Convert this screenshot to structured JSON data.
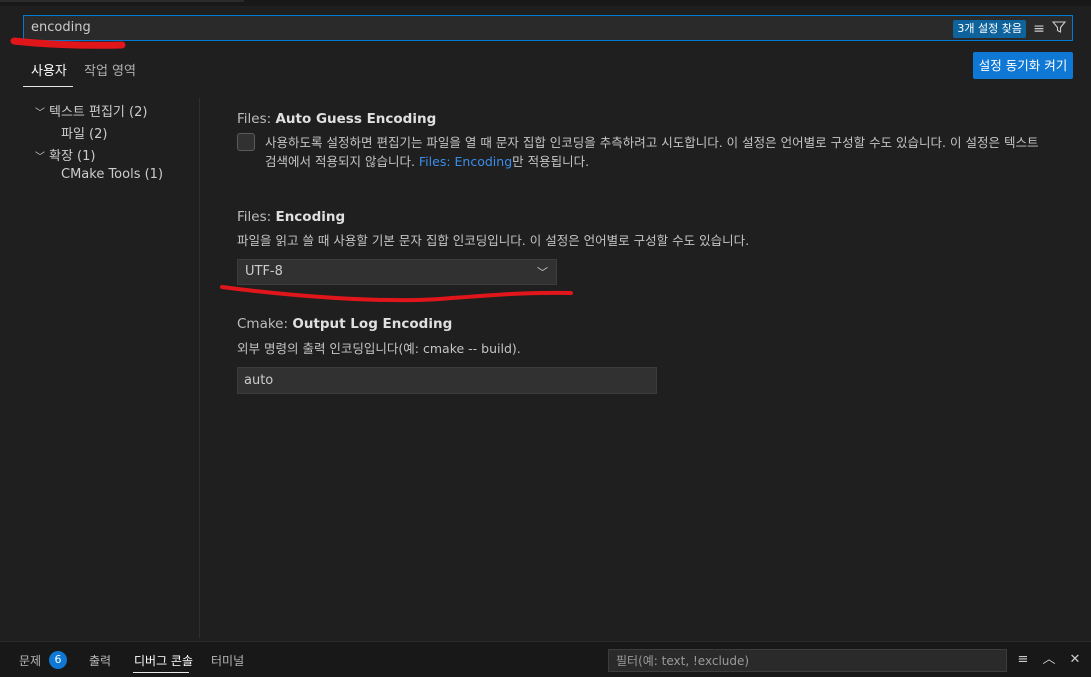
{
  "search": {
    "value": "encoding",
    "result_badge": "3개 설정 찾음",
    "clear_icon": "clear-filter-icon",
    "filter_icon": "funnel-icon"
  },
  "tabs": [
    {
      "label": "사용자"
    },
    {
      "label": "작업 영역"
    }
  ],
  "sync_button": {
    "label": "설정 동기화 켜기"
  },
  "tree": [
    {
      "label": "텍스트 편집기 (2)",
      "expanded": true
    },
    {
      "label": "파일 (2)"
    },
    {
      "label": "확장 (1)",
      "expanded": true
    },
    {
      "label": "CMake Tools (1)"
    }
  ],
  "settings": {
    "auto_guess": {
      "category": "Files: ",
      "name": "Auto Guess Encoding",
      "desc_line1": "사용하도록 설정하면 편집기는 파일을 열 때 문자 집합 인코딩을 추측하려고 시도합니다. 이 설정은 언어별로 구성할 수도 있습니다. 이 설정은 텍스트",
      "desc_line2_pre": "검색에서 적용되지 않습니다. ",
      "desc_link": "Files: Encoding",
      "desc_line2_post": "만 적용됩니다.",
      "checked": false
    },
    "encoding": {
      "category": "Files: ",
      "name": "Encoding",
      "desc": "파일을 읽고 쓸 때 사용할 기본 문자 집합 인코딩입니다. 이 설정은 언어별로 구성할 수도 있습니다.",
      "value": "UTF-8"
    },
    "cmake_log": {
      "category": "Cmake: ",
      "name": "Output Log Encoding",
      "desc": "외부 명령의 출력 인코딩입니다(예: cmake -- build).",
      "value": "auto"
    }
  },
  "panel": {
    "tabs": [
      {
        "label": "문제"
      },
      {
        "label": "출력"
      },
      {
        "label": "디버그 콘솔"
      },
      {
        "label": "터미널"
      }
    ],
    "problems_count": "6",
    "filter_placeholder": "필터(예: text, !exclude)"
  },
  "colors": {
    "accent": "#0078d4",
    "annotation": "#e0161b",
    "background": "#1f1f1f"
  }
}
